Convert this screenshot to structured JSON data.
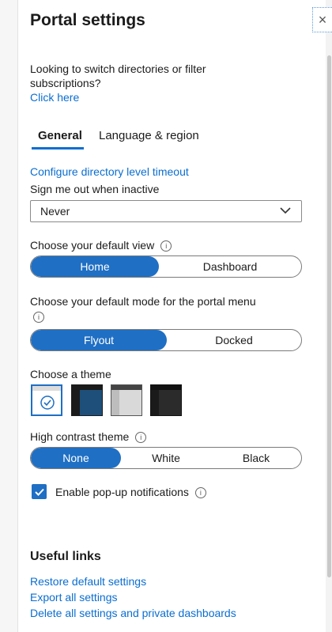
{
  "panel": {
    "title": "Portal settings",
    "close_icon": "×"
  },
  "intro": {
    "text": "Looking to switch directories or filter subscriptions?",
    "link": "Click here"
  },
  "tabs": [
    {
      "label": "General",
      "active": true
    },
    {
      "label": "Language & region",
      "active": false
    }
  ],
  "timeout": {
    "link": "Configure directory level timeout",
    "label": "Sign me out when inactive",
    "value": "Never"
  },
  "default_view": {
    "label": "Choose your default view",
    "options": [
      "Home",
      "Dashboard"
    ],
    "selected": "Home"
  },
  "menu_mode": {
    "label": "Choose your default mode for the portal menu",
    "options": [
      "Flyout",
      "Docked"
    ],
    "selected": "Flyout"
  },
  "theme": {
    "label": "Choose a theme",
    "options": [
      "Light",
      "Azure",
      "Silver",
      "Dark"
    ],
    "selected": "Light"
  },
  "high_contrast": {
    "label": "High contrast theme",
    "options": [
      "None",
      "White",
      "Black"
    ],
    "selected": "None"
  },
  "popups": {
    "label": "Enable pop-up notifications",
    "checked": true
  },
  "useful_links": {
    "title": "Useful links",
    "links": [
      "Restore default settings",
      "Export all settings",
      "Delete all settings and private dashboards"
    ]
  },
  "colors": {
    "accent": "#1f6fc4",
    "link": "#0a6ed1"
  },
  "icons": {
    "info": "info-icon",
    "chevron": "chevron-down-icon",
    "check": "checkmark-icon",
    "close": "close-icon"
  }
}
